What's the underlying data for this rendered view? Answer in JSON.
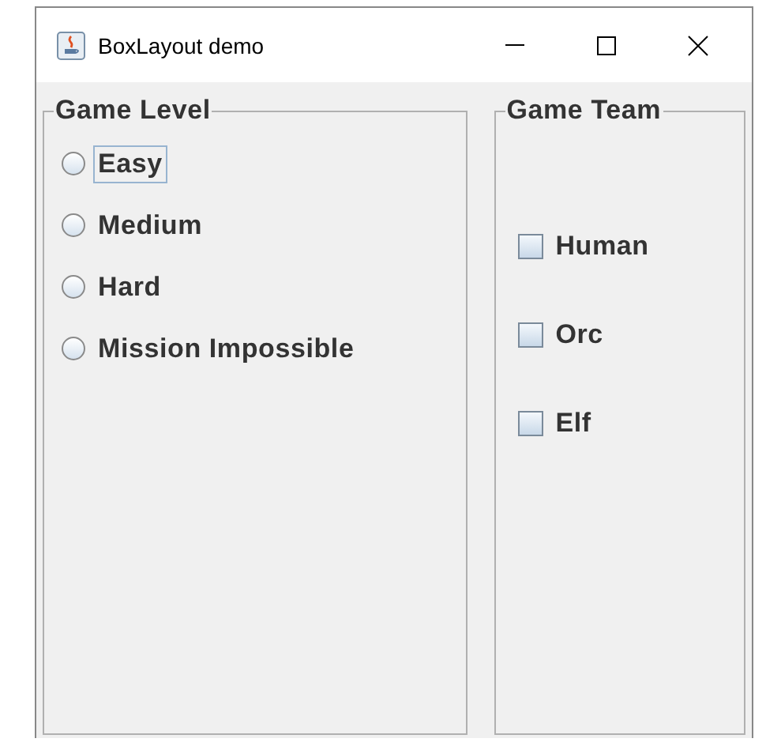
{
  "window": {
    "title": "BoxLayout demo"
  },
  "game_level": {
    "title": "Game Level",
    "options": [
      {
        "label": "Easy",
        "selected": false,
        "focused": true
      },
      {
        "label": "Medium",
        "selected": false,
        "focused": false
      },
      {
        "label": "Hard",
        "selected": false,
        "focused": false
      },
      {
        "label": "Mission Impossible",
        "selected": false,
        "focused": false
      }
    ]
  },
  "game_team": {
    "title": "Game Team",
    "options": [
      {
        "label": "Human",
        "checked": false
      },
      {
        "label": "Orc",
        "checked": false
      },
      {
        "label": "Elf",
        "checked": false
      }
    ]
  }
}
